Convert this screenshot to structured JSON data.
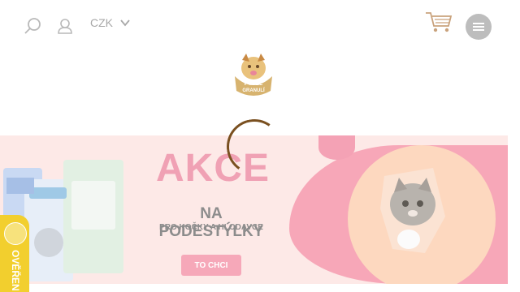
{
  "header": {
    "currency": "CZK",
    "icons": {
      "search": "search-icon",
      "user": "user-icon",
      "chevron": "chevron-down-icon",
      "cart": "cart-icon",
      "menu": "hamburger-icon"
    }
  },
  "logo": {
    "text_line1": "PYTEL",
    "text_line2": "GRANULÍ"
  },
  "banner": {
    "title": "AKCE",
    "subtitle": "NA PODESTÝLKY",
    "subtitle2": "PRO KOČKY A HLODAVCE",
    "cta": "TO CHCI"
  },
  "badge": {
    "text": "OVĚŘEN"
  },
  "colors": {
    "accent_pink": "#f0a1b4",
    "brown": "#7a5020",
    "badge_yellow": "#f2cf2e"
  }
}
